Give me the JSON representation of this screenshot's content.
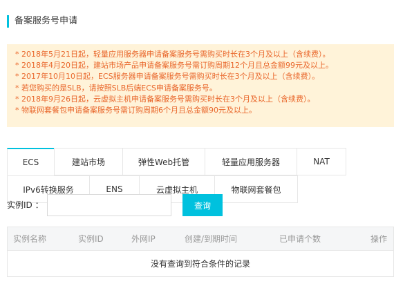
{
  "page": {
    "title": "备案服务号申请"
  },
  "notice": {
    "lines": [
      "* 2018年5月21日起，轻量应用服务器申请备案服务号需购买时长在3个月及以上（含续费）。",
      "* 2018年4月20日起，建站市场产品申请备案服务号需订购周期12个月且总金额99元及以上。",
      "* 2017年10月10日起，ECS服务器申请备案服务号需购买时长在3个月及以上（含续费）。",
      "* 若您购买的是SLB，请按照SLB后端ECS申请备案服务号。",
      "* 2018年9月26日起，云虚拟主机申请备案服务号需购买时长在3个月及以上（含续费）。",
      "* 物联网套餐包申请备案服务号需订购周期6个月且总金额90元及以上。"
    ],
    "text_color": "#e9662a",
    "background": "#fff3d9"
  },
  "tabs": [
    {
      "label": "ECS",
      "active": true
    },
    {
      "label": "建站市场",
      "active": false
    },
    {
      "label": "弹性Web托管",
      "active": false
    },
    {
      "label": "轻量应用服务器",
      "active": false
    },
    {
      "label": "NAT",
      "active": false
    },
    {
      "label": "IPv6转换服务",
      "active": false
    },
    {
      "label": "ENS",
      "active": false
    },
    {
      "label": "云虚拟主机",
      "active": false
    },
    {
      "label": "物联网套餐包",
      "active": false
    }
  ],
  "search": {
    "label": "实例ID ：",
    "value": "",
    "button_label": "查询"
  },
  "table": {
    "columns": [
      "实例名称",
      "实例ID",
      "外网IP",
      "创建/到期时间",
      "已申请个数",
      "操作"
    ],
    "empty_text": "没有查询到符合条件的记录"
  },
  "colors": {
    "accent": "#00c1de"
  }
}
